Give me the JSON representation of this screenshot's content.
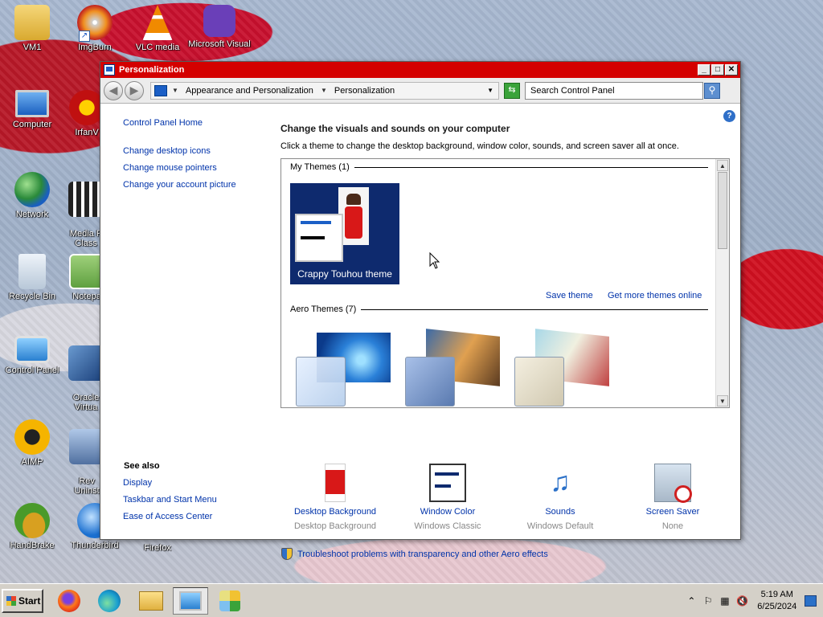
{
  "desktop": {
    "icons": [
      {
        "name": "vm1-icon",
        "label": "VM1"
      },
      {
        "name": "imgburn-icon",
        "label": "ImgBurn"
      },
      {
        "name": "vlc-icon",
        "label": "VLC media"
      },
      {
        "name": "visual-studio-icon",
        "label": "Microsoft Visual"
      },
      {
        "name": "computer-icon",
        "label": "Computer"
      },
      {
        "name": "irfanview-icon",
        "label": "IrfanV"
      },
      {
        "name": "network-icon",
        "label": "Network"
      },
      {
        "name": "media-player-classic-icon",
        "label": "Media P\nClass"
      },
      {
        "name": "recycle-bin-icon",
        "label": "Recycle Bin"
      },
      {
        "name": "notepad-icon",
        "label": "Notepa"
      },
      {
        "name": "control-panel-icon",
        "label": "Control Panel"
      },
      {
        "name": "virtualbox-icon",
        "label": "Oracle\nVirtua"
      },
      {
        "name": "aimp-icon",
        "label": "AIMP"
      },
      {
        "name": "revo-uninstaller-icon",
        "label": "Rev\nUninst"
      },
      {
        "name": "handbrake-icon",
        "label": "HandBrake"
      },
      {
        "name": "thunderbird-icon",
        "label": "Thunderbird"
      },
      {
        "name": "firefox-icon",
        "label": "Firefox"
      }
    ]
  },
  "window": {
    "title": "Personalization",
    "breadcrumb": [
      "Appearance and Personalization",
      "Personalization"
    ],
    "search_placeholder": "Search Control Panel"
  },
  "left_pane": {
    "links": [
      "Control Panel Home",
      "Change desktop icons",
      "Change mouse pointers",
      "Change your account picture"
    ],
    "see_also_title": "See also",
    "see_also": [
      "Display",
      "Taskbar and Start Menu",
      "Ease of Access Center"
    ]
  },
  "main": {
    "heading": "Change the visuals and sounds on your computer",
    "subtext": "Click a theme to change the desktop background, window color, sounds, and screen saver all at once.",
    "my_themes_header": "My Themes (1)",
    "my_theme_name": "Crappy Touhou theme",
    "save_theme": "Save theme",
    "get_more": "Get more themes online",
    "aero_header": "Aero Themes (7)",
    "tiles": [
      {
        "name": "Desktop Background",
        "value": "Desktop Background"
      },
      {
        "name": "Window Color",
        "value": "Windows Classic"
      },
      {
        "name": "Sounds",
        "value": "Windows Default"
      },
      {
        "name": "Screen Saver",
        "value": "None"
      }
    ],
    "troubleshoot": "Troubleshoot problems with transparency and other Aero effects"
  },
  "taskbar": {
    "start_label": "Start",
    "time": "5:19 AM",
    "date": "6/25/2024"
  },
  "colors": {
    "titlebar": "#d40000",
    "link": "#0033aa",
    "theme_bg": "#0e2a6e"
  }
}
